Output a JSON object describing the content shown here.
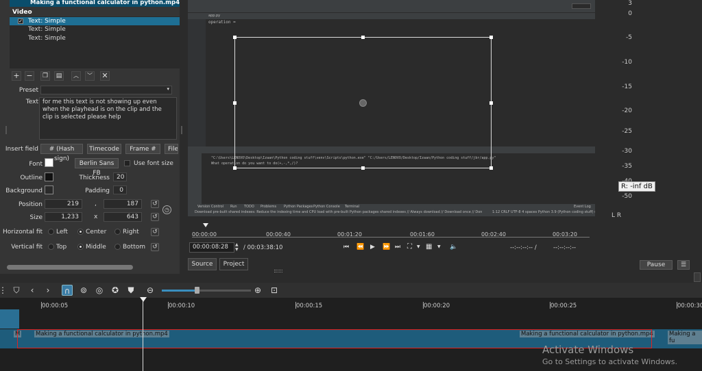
{
  "filters": {
    "clip_title": "Making a functional calculator in python.mp4",
    "section": "Video",
    "items": [
      {
        "label": "Text: Simple",
        "checked": true,
        "selected": true
      },
      {
        "label": "Text: Simple",
        "checked": false,
        "selected": false
      },
      {
        "label": "Text: Simple",
        "checked": false,
        "selected": false
      }
    ],
    "toolbar_icons": [
      "add-icon",
      "remove-icon",
      "copy-icon",
      "paste-icon",
      "move-up-icon",
      "move-down-icon",
      "close-icon"
    ]
  },
  "properties": {
    "preset_label": "Preset",
    "preset_value": "",
    "text_label": "Text",
    "text_value": "for me this text is not showing up even when the playhead is on the clip and the clip is selected please help",
    "insert_field_label": "Insert field",
    "insert_buttons": [
      "# (Hash sign)",
      "Timecode",
      "Frame #",
      "File"
    ],
    "font_label": "Font",
    "font_button": "Berlin Sans FB",
    "use_font_size": "Use font size",
    "outline_label": "Outline",
    "thickness_label": "Thickness",
    "thickness_value": "20",
    "background_label": "Background",
    "padding_label": "Padding",
    "padding_value": "0",
    "position_label": "Position",
    "position_x": "219",
    "position_sep": ",",
    "position_y": "187",
    "size_label": "Size",
    "size_w": "1,233",
    "size_sep": "x",
    "size_h": "643",
    "hfit_label": "Horizontal fit",
    "hfit_options": [
      "Left",
      "Center",
      "Right"
    ],
    "hfit_selected": "Center",
    "vfit_label": "Vertical fit",
    "vfit_options": [
      "Top",
      "Middle",
      "Bottom"
    ],
    "vfit_selected": "Middle"
  },
  "ide": {
    "editor_line": "operation =",
    "tab": "app.py",
    "run_output_1": "\"C:\\Users\\LENOVO\\Desktop\\Izaan\\Python coding stuff\\venv\\Scripts\\python.exe\" \"C:/Users/LENOVO/Desktop/Izaan/Python coding stuff/jbr/app.py\"",
    "run_output_2": "What operation do you want to do(+,-,*,/)?",
    "bottom_tabs": [
      "Version Control",
      "Run",
      "TODO",
      "Problems",
      "Python Packages",
      "Python Console",
      "Terminal"
    ],
    "event_log": "Event Log",
    "status_left": "Download pre-built shared indexes: Reduce the indexing time and CPU load with pre-built Python packages shared indexes // Always download // Download once // Don't show again // Confi... (31 minutes",
    "status_right": "1:12  CRLF  UTF-8  4 spaces  Python 3.9 (Python coding stuff) (2)"
  },
  "audio_meter": {
    "ticks": [
      "3",
      "0",
      "-5",
      "-10",
      "-15",
      "-20",
      "-25",
      "-30",
      "-35",
      "-40",
      "-45",
      "-50"
    ],
    "channels": "L R",
    "tooltip": "R: -inf dB"
  },
  "player": {
    "ruler_labels": [
      "00:00:00",
      "00:00:40",
      "00:01:20",
      "00:01:60",
      "00:02:40",
      "00:03:20"
    ],
    "current_time": "00:00:08:28",
    "total_time": "/ 00:03:38:10",
    "in_point": "--:--:--:-- /",
    "out_point": "--:--:--:--",
    "tabs": [
      "Source",
      "Project"
    ],
    "pause": "Pause"
  },
  "timeline": {
    "time_labels": [
      "00:00:05",
      "00:00:10",
      "00:00:15",
      "00:00:20",
      "00:00:25",
      "00:00:30"
    ],
    "clip_label": "Making a functional calculator in python.mp4",
    "clip_label_short": "Making a fu",
    "clip_label_left": "M"
  },
  "windows_notice": {
    "title": "Activate Windows",
    "subtitle": "Go to Settings to activate Windows."
  }
}
